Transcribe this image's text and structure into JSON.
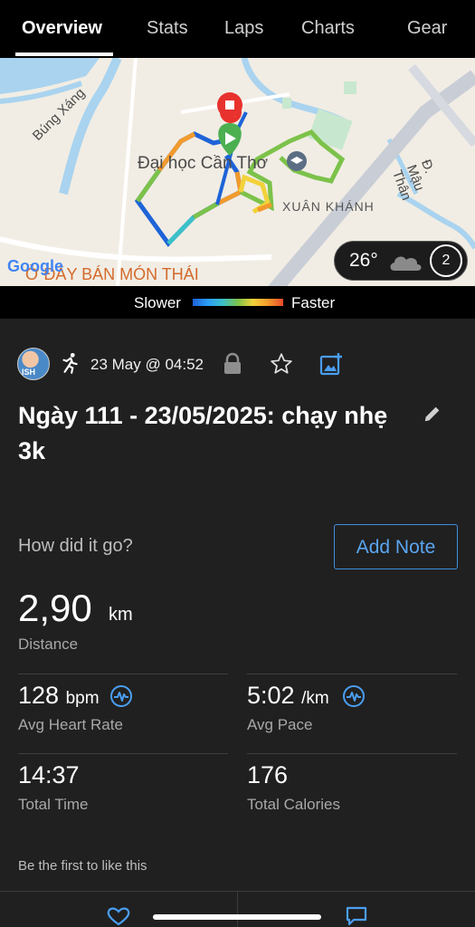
{
  "tabs": [
    "Overview",
    "Stats",
    "Laps",
    "Charts",
    "Gear"
  ],
  "map": {
    "labels": {
      "area1": "Búng Xáng",
      "university": "Đại học Cần Thơ",
      "district": "XUÂN KHÁNH",
      "street": "Đ. Mậu Thân",
      "restaurant": "Ở ĐÂY BÁN MÓN THÁI",
      "logo": "Google"
    },
    "weather": {
      "temperature": "26°",
      "laps": "2",
      "icon": "cloud-icon"
    }
  },
  "legend": {
    "slower": "Slower",
    "faster": "Faster"
  },
  "activity": {
    "avatar_text": "ISH",
    "date": "23 May @ 04:52",
    "title": "Ngày 111 - 23/05/2025: chạy nhẹ 3k",
    "question": "How did it go?",
    "add_note": "Add Note"
  },
  "distance": {
    "value": "2,90",
    "unit": "km",
    "label": "Distance"
  },
  "stats": {
    "heart_rate": {
      "value": "128",
      "unit": "bpm",
      "label": "Avg Heart Rate"
    },
    "pace": {
      "value": "5:02",
      "unit": "/km",
      "label": "Avg Pace"
    },
    "time": {
      "value": "14:37",
      "label": "Total Time"
    },
    "calories": {
      "value": "176",
      "label": "Total Calories"
    }
  },
  "social": {
    "like_text": "Be the first to like this"
  },
  "colors": {
    "accent": "#3d8fe0",
    "background": "#202020",
    "tabbar": "#000000"
  }
}
